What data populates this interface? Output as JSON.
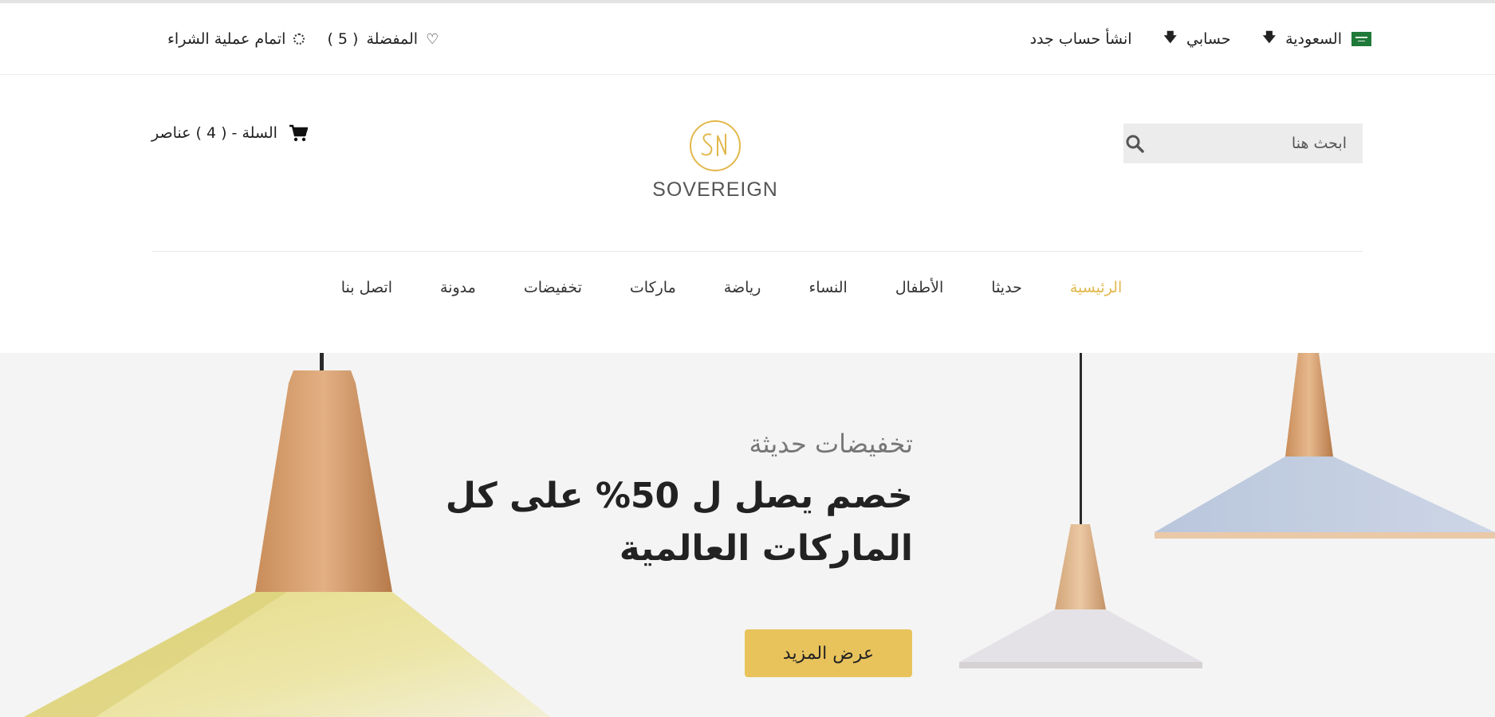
{
  "topbar": {
    "country_label": "السعودية",
    "account_label": "حسابي",
    "register_label": "انشأ حساب جدد",
    "wishlist_label": "المفضلة",
    "wishlist_count": "( 5 )",
    "checkout_label": "اتمام عملية الشراء"
  },
  "header": {
    "search_placeholder": "ابحث هنا",
    "logo_text": "SOVEREIGN",
    "cart_label": "السلة - ( 4 ) عناصر"
  },
  "nav": {
    "items": [
      {
        "label": "الرئيسية",
        "active": true
      },
      {
        "label": "حديثا"
      },
      {
        "label": "الأطفال"
      },
      {
        "label": "النساء"
      },
      {
        "label": "رياضة"
      },
      {
        "label": "ماركات"
      },
      {
        "label": "تخفيضات"
      },
      {
        "label": "مدونة"
      },
      {
        "label": "اتصل بنا"
      }
    ]
  },
  "hero": {
    "subtitle": "تخفيضات حديثة",
    "title_line1": "خصم يصل ل 50% على كل",
    "title_line2": "الماركات العالمية",
    "button_label": "عرض المزيد"
  },
  "colors": {
    "accent": "#e2b84c",
    "button": "#e8c35c",
    "hero_bg": "#f4f4f4"
  }
}
